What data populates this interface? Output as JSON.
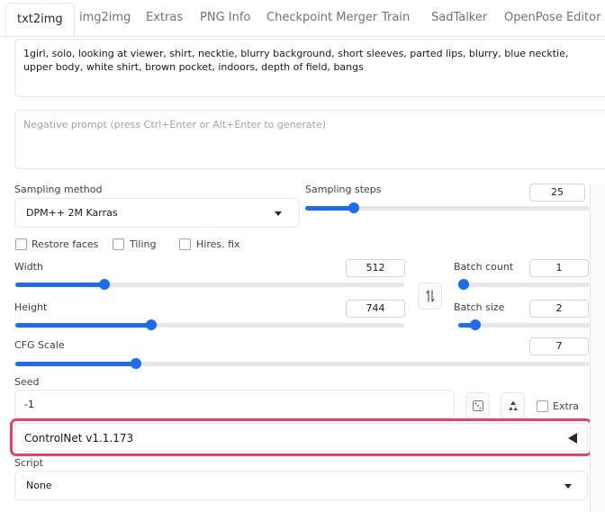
{
  "tabs": [
    {
      "label": "txt2img",
      "active": true
    },
    {
      "label": "img2img"
    },
    {
      "label": "Extras"
    },
    {
      "label": "PNG Info"
    },
    {
      "label": "Checkpoint Merger"
    },
    {
      "label": "Train"
    },
    {
      "label": "SadTalker"
    },
    {
      "label": "OpenPose Editor"
    }
  ],
  "prompt": {
    "value": "1girl, solo, looking at viewer, shirt, necktie, blurry background, short sleeves, parted lips, blurry, blue necktie, upper body, white shirt, brown pocket, indoors, depth of field, bangs"
  },
  "negative_prompt": {
    "placeholder": "Negative prompt (press Ctrl+Enter or Alt+Enter to generate)"
  },
  "sampling": {
    "method_label": "Sampling method",
    "method_value": "DPM++ 2M Karras",
    "steps_label": "Sampling steps",
    "steps_value": "25",
    "steps_fraction": 0.17
  },
  "options": {
    "restore_faces": "Restore faces",
    "tiling": "Tiling",
    "hires_fix": "Hires. fix"
  },
  "size": {
    "width_label": "Width",
    "width_value": "512",
    "width_fraction": 0.23,
    "height_label": "Height",
    "height_value": "744",
    "height_fraction": 0.35,
    "swap_icon": "swap-vertical-icon"
  },
  "batch": {
    "count_label": "Batch count",
    "count_value": "1",
    "count_fraction": 0.0,
    "size_label": "Batch size",
    "size_value": "2",
    "size_fraction": 0.13
  },
  "cfg": {
    "label": "CFG Scale",
    "value": "7",
    "fraction": 0.21
  },
  "seed": {
    "label": "Seed",
    "value": "-1",
    "dice_icon": "dice-icon",
    "recycle_icon": "recycle-icon",
    "extra_label": "Extra"
  },
  "controlnet": {
    "label": "ControlNet v1.1.173",
    "highlight_color": "#e8416f"
  },
  "script": {
    "label": "Script",
    "value": "None"
  }
}
